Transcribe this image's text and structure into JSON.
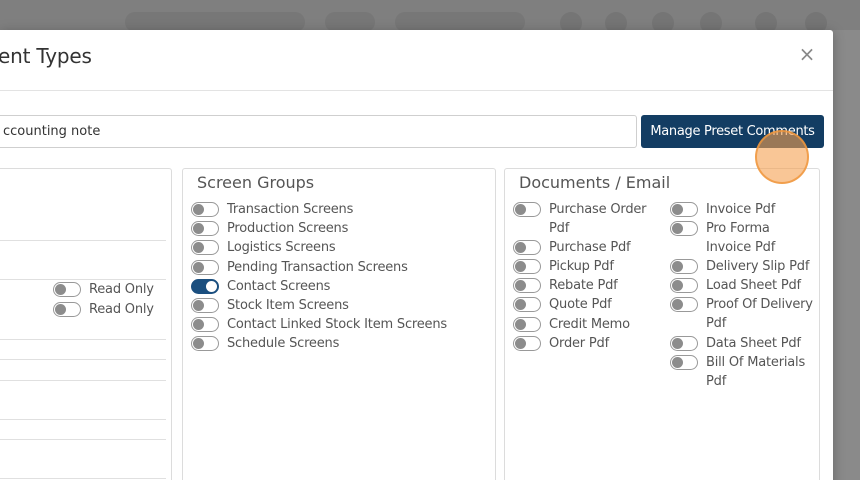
{
  "dialog": {
    "title": "ent Types",
    "close_icon": "×"
  },
  "note_input": {
    "value": "ccounting note"
  },
  "preset_button": {
    "label": "Manage Preset Comments"
  },
  "left_panel": {
    "toggles": [
      {
        "label": "Read Only",
        "on": false
      },
      {
        "label": "Read Only",
        "on": false
      }
    ]
  },
  "screen_groups": {
    "title": "Screen Groups",
    "items": [
      {
        "label": "Transaction Screens",
        "on": false
      },
      {
        "label": "Production Screens",
        "on": false
      },
      {
        "label": "Logistics Screens",
        "on": false
      },
      {
        "label": "Pending Transaction Screens",
        "on": false
      },
      {
        "label": "Contact Screens",
        "on": true
      },
      {
        "label": "Stock Item Screens",
        "on": false
      },
      {
        "label": "Contact Linked Stock Item Screens",
        "on": false
      },
      {
        "label": "Schedule Screens",
        "on": false
      }
    ]
  },
  "documents": {
    "title": "Documents / Email",
    "col1": [
      {
        "label": "Purchase Order Pdf",
        "on": false
      },
      {
        "label": "Purchase Pdf",
        "on": false
      },
      {
        "label": "Pickup Pdf",
        "on": false
      },
      {
        "label": "Rebate Pdf",
        "on": false
      },
      {
        "label": "Quote Pdf",
        "on": false
      },
      {
        "label": "Credit Memo",
        "on": false
      },
      {
        "label": "Order Pdf",
        "on": false
      }
    ],
    "col2": [
      {
        "label": "Invoice Pdf",
        "on": false
      },
      {
        "label": "Pro Forma Invoice Pdf",
        "on": false
      },
      {
        "label": "Delivery Slip Pdf",
        "on": false
      },
      {
        "label": "Load Sheet Pdf",
        "on": false
      },
      {
        "label": "Proof Of Delivery Pdf",
        "on": false
      },
      {
        "label": "Data Sheet Pdf",
        "on": false
      },
      {
        "label": "Bill Of Materials Pdf",
        "on": false
      }
    ]
  }
}
